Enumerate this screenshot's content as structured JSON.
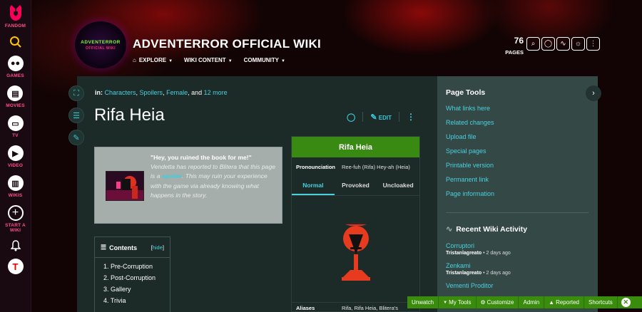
{
  "global_nav": {
    "brand": "FANDOM",
    "items": [
      {
        "label": "GAMES"
      },
      {
        "label": "MOVIES"
      },
      {
        "label": "TV"
      },
      {
        "label": "VIDEO"
      },
      {
        "label": "WIKIS"
      },
      {
        "label": "START A WIKI"
      }
    ]
  },
  "header": {
    "logo_line1": "ADVENTERROR",
    "logo_line2": "OFFICIAL WIKI",
    "title": "ADVENTERROR OFFICIAL WIKI",
    "nav": [
      "EXPLORE",
      "WIKI CONTENT",
      "COMMUNITY"
    ],
    "pages_count": "76",
    "pages_label": "PAGES"
  },
  "article": {
    "categories_prefix": "in:",
    "categories": [
      "Characters",
      "Spoilers",
      "Female"
    ],
    "categories_more": "12 more",
    "title": "Rifa Heia",
    "edit_label": "EDIT",
    "spoiler": {
      "quote": "\"Hey, you ruined the book for me!\"",
      "text_before": "Vendetta has reported to Blitera that this page is a ",
      "highlight": "spoiler",
      "text_after": ". This may ruin your experience with the game via already knowing what happens in the story."
    },
    "toc": {
      "title": "Contents",
      "hide": "hide",
      "items": [
        "1. Pre-Corruption",
        "2. Post-Corruption",
        "3. Gallery",
        "4. Trivia"
      ]
    },
    "infobox": {
      "title": "Rifa Heia",
      "pron_label": "Pronounciation",
      "pron_value": "Ree-fuh (Rifa) Hey-ah (Heia)",
      "tabs": [
        "Normal",
        "Provoked",
        "Uncloaked"
      ],
      "aliases_label": "Aliases",
      "aliases_value": "Rifa, Rifa Heia, Blitera's"
    }
  },
  "page_tools": {
    "title": "Page Tools",
    "links": [
      "What links here",
      "Related changes",
      "Upload file",
      "Special pages",
      "Printable version",
      "Permanent link",
      "Page information"
    ]
  },
  "recent_activity": {
    "title": "Recent Wiki Activity",
    "items": [
      {
        "title": "Corruptori",
        "user": "Tristanlagreato",
        "time": "2 days ago"
      },
      {
        "title": "Zenkami",
        "user": "Tristanlagreato",
        "time": "2 days ago"
      },
      {
        "title": "Vementi Proditor",
        "user": "",
        "time": ""
      }
    ]
  },
  "toolbar": {
    "items": [
      "Unwatch",
      "My Tools",
      "Customize",
      "Admin",
      "Reported",
      "Shortcuts"
    ]
  },
  "colors": {
    "accent": "#49d1e0",
    "infobox_title_bg": "#388a12",
    "toolbar_bg": "#3a8c0c",
    "fandom_pink": "#ff4d8a"
  }
}
